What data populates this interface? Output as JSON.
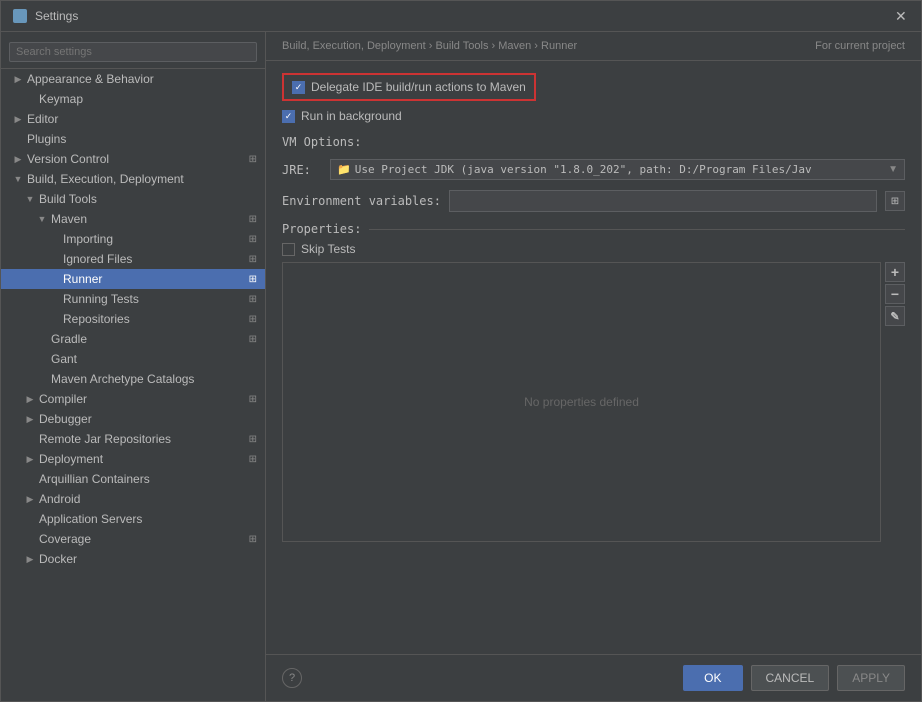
{
  "window": {
    "title": "Settings"
  },
  "breadcrumb": {
    "path": "Build, Execution, Deployment  ›  Build Tools  ›  Maven  ›  Runner",
    "for_project": "For current project"
  },
  "sidebar": {
    "search_placeholder": "Search settings",
    "items": [
      {
        "id": "appearance-behavior",
        "label": "Appearance & Behavior",
        "level": 0,
        "has_arrow": true,
        "expanded": true
      },
      {
        "id": "keymap",
        "label": "Keymap",
        "level": 1,
        "has_arrow": false
      },
      {
        "id": "editor",
        "label": "Editor",
        "level": 0,
        "has_arrow": true,
        "expanded": false
      },
      {
        "id": "plugins",
        "label": "Plugins",
        "level": 0,
        "has_arrow": false
      },
      {
        "id": "version-control",
        "label": "Version Control",
        "level": 0,
        "has_arrow": true,
        "has_icon": true
      },
      {
        "id": "build-execution",
        "label": "Build, Execution, Deployment",
        "level": 0,
        "has_arrow": true,
        "expanded": true
      },
      {
        "id": "build-tools",
        "label": "Build Tools",
        "level": 1,
        "has_arrow": true,
        "expanded": true
      },
      {
        "id": "maven",
        "label": "Maven",
        "level": 2,
        "has_arrow": true,
        "expanded": true,
        "has_icon": true
      },
      {
        "id": "importing",
        "label": "Importing",
        "level": 3,
        "has_icon": true
      },
      {
        "id": "ignored-files",
        "label": "Ignored Files",
        "level": 3,
        "has_icon": true
      },
      {
        "id": "runner",
        "label": "Runner",
        "level": 3,
        "selected": true,
        "has_icon": true
      },
      {
        "id": "running-tests",
        "label": "Running Tests",
        "level": 3,
        "has_icon": true
      },
      {
        "id": "repositories",
        "label": "Repositories",
        "level": 3,
        "has_icon": true
      },
      {
        "id": "gradle",
        "label": "Gradle",
        "level": 2,
        "has_icon": true
      },
      {
        "id": "gant",
        "label": "Gant",
        "level": 2
      },
      {
        "id": "maven-archetype-catalogs",
        "label": "Maven Archetype Catalogs",
        "level": 2
      },
      {
        "id": "compiler",
        "label": "Compiler",
        "level": 1,
        "has_arrow": true,
        "has_icon": true
      },
      {
        "id": "debugger",
        "label": "Debugger",
        "level": 1,
        "has_arrow": true
      },
      {
        "id": "remote-jar-repositories",
        "label": "Remote Jar Repositories",
        "level": 1,
        "has_icon": true
      },
      {
        "id": "deployment",
        "label": "Deployment",
        "level": 1,
        "has_arrow": true,
        "has_icon": true
      },
      {
        "id": "arquillian-containers",
        "label": "Arquillian Containers",
        "level": 1
      },
      {
        "id": "android",
        "label": "Android",
        "level": 1,
        "has_arrow": true
      },
      {
        "id": "application-servers",
        "label": "Application Servers",
        "level": 1
      },
      {
        "id": "coverage",
        "label": "Coverage",
        "level": 1,
        "has_icon": true
      },
      {
        "id": "docker",
        "label": "Docker",
        "level": 1,
        "has_arrow": true
      }
    ]
  },
  "main": {
    "delegate_checkbox": {
      "checked": true,
      "label": "Delegate IDE build/run actions to Maven"
    },
    "run_background_checkbox": {
      "checked": true,
      "label": "Run in background"
    },
    "vm_options": {
      "label": "VM Options:",
      "value": ""
    },
    "jre": {
      "label": "JRE:",
      "value": "Use Project JDK (java version \"1.8.0_202\", path: D:/Program Files/Jav"
    },
    "env_vars": {
      "label": "Environment variables:",
      "value": ""
    },
    "properties": {
      "label": "Properties:",
      "skip_tests": {
        "checked": false,
        "label": "Skip Tests"
      },
      "empty_text": "No properties defined"
    }
  },
  "footer": {
    "ok_label": "OK",
    "cancel_label": "CANCEL",
    "apply_label": "APPLY"
  }
}
